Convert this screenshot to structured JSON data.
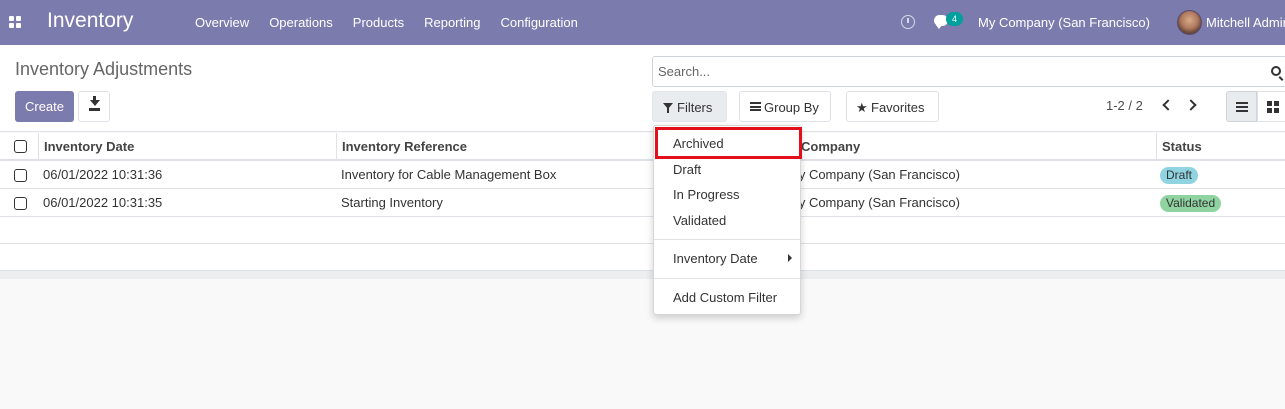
{
  "navbar": {
    "brand": "Inventory",
    "menu": [
      "Overview",
      "Operations",
      "Products",
      "Reporting",
      "Configuration"
    ],
    "chat_count": "4",
    "company": "My Company (San Francisco)",
    "user": "Mitchell Admin",
    "bg_color": "#7c7bad"
  },
  "control_panel": {
    "title": "Inventory Adjustments",
    "create_label": "Create",
    "search_placeholder": "Search...",
    "filters_label": "Filters",
    "groupby_label": "Group By",
    "favorites_label": "Favorites",
    "pager": "1-2 / 2"
  },
  "table": {
    "columns": [
      "Inventory Date",
      "Inventory Reference",
      "Company",
      "Status"
    ],
    "rows": [
      {
        "date": "06/01/2022 10:31:36",
        "reference": "Inventory for Cable Management Box",
        "company": "My Company (San Francisco)",
        "status": "Draft",
        "status_color": "#8fd4e0"
      },
      {
        "date": "06/01/2022 10:31:35",
        "reference": "Starting Inventory",
        "company": "My Company (San Francisco)",
        "status": "Validated",
        "status_color": "#8ed3a0"
      }
    ]
  },
  "filters_dropdown": {
    "items": [
      "Archived",
      "Draft",
      "In Progress",
      "Validated"
    ],
    "date_filter": "Inventory Date",
    "custom_filter": "Add Custom Filter",
    "highlight_color": "#e3101b"
  }
}
